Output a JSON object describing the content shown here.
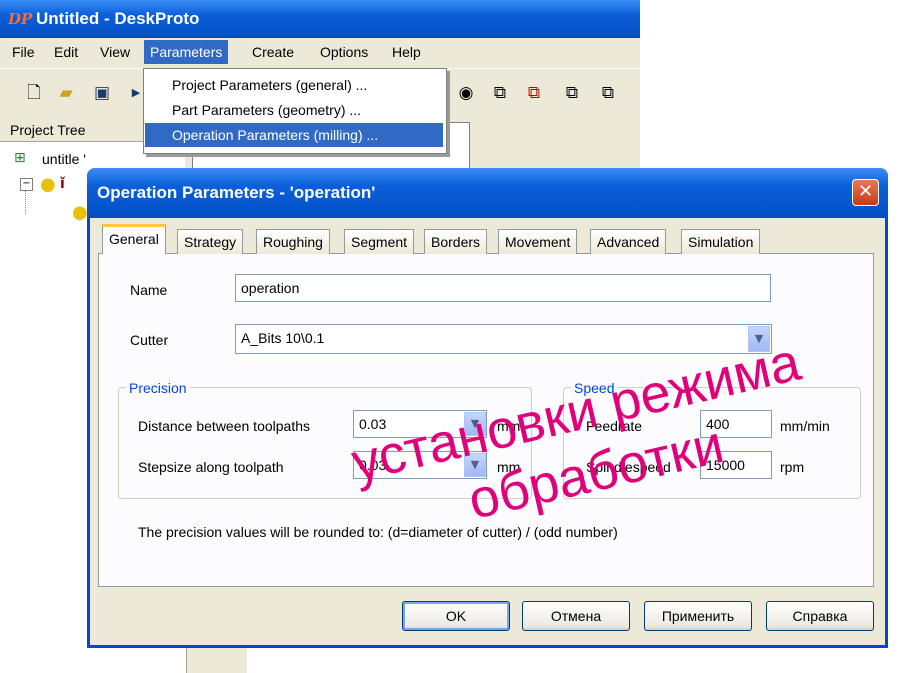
{
  "app": {
    "logo_text": "DP",
    "title": "Untitled - DeskProto"
  },
  "menubar": {
    "items": [
      "File",
      "Edit",
      "View",
      "Parameters",
      "Create",
      "Options",
      "Help"
    ]
  },
  "parameters_menu": {
    "items": [
      "Project Parameters (general) ...",
      "Part Parameters (geometry) ...",
      "Operation Parameters (milling) ..."
    ],
    "highlighted_index": 2
  },
  "project_tree": {
    "header": "Project Tree",
    "root_label": "untitle '"
  },
  "dialog": {
    "title": "Operation Parameters - 'operation'",
    "tabs": [
      "General",
      "Strategy",
      "Roughing",
      "Segment",
      "Borders",
      "Movement",
      "Advanced",
      "Simulation"
    ],
    "active_tab": "General",
    "name_label": "Name",
    "name_value": "operation",
    "cutter_label": "Cutter",
    "cutter_value": "A_Bits 10\\0.1",
    "precision": {
      "title": "Precision",
      "distance_label": "Distance between toolpaths",
      "distance_value": "0.03",
      "distance_unit": "mm",
      "stepsize_label": "Stepsize along toolpath",
      "stepsize_value": "0.03",
      "stepsize_unit": "mm"
    },
    "speed": {
      "title": "Speed",
      "feedrate_label": "Feedrate",
      "feedrate_value": "400",
      "feedrate_unit": "mm/min",
      "spindle_label": "Spindlespeed",
      "spindle_value": "15000",
      "spindle_unit": "rpm"
    },
    "note": "The precision values will be rounded to:  (d=diameter of cutter) / (odd number)",
    "buttons": {
      "ok": "OK",
      "cancel": "Отмена",
      "apply": "Применить",
      "help": "Справка"
    }
  },
  "overlay_caption": {
    "line1": "установки режима",
    "line2": "обработки",
    "color": "#e0007a"
  },
  "colors": {
    "xp_titlebar": "#0553cb",
    "menu_highlight": "#316ac5",
    "group_title": "#0046d5"
  }
}
